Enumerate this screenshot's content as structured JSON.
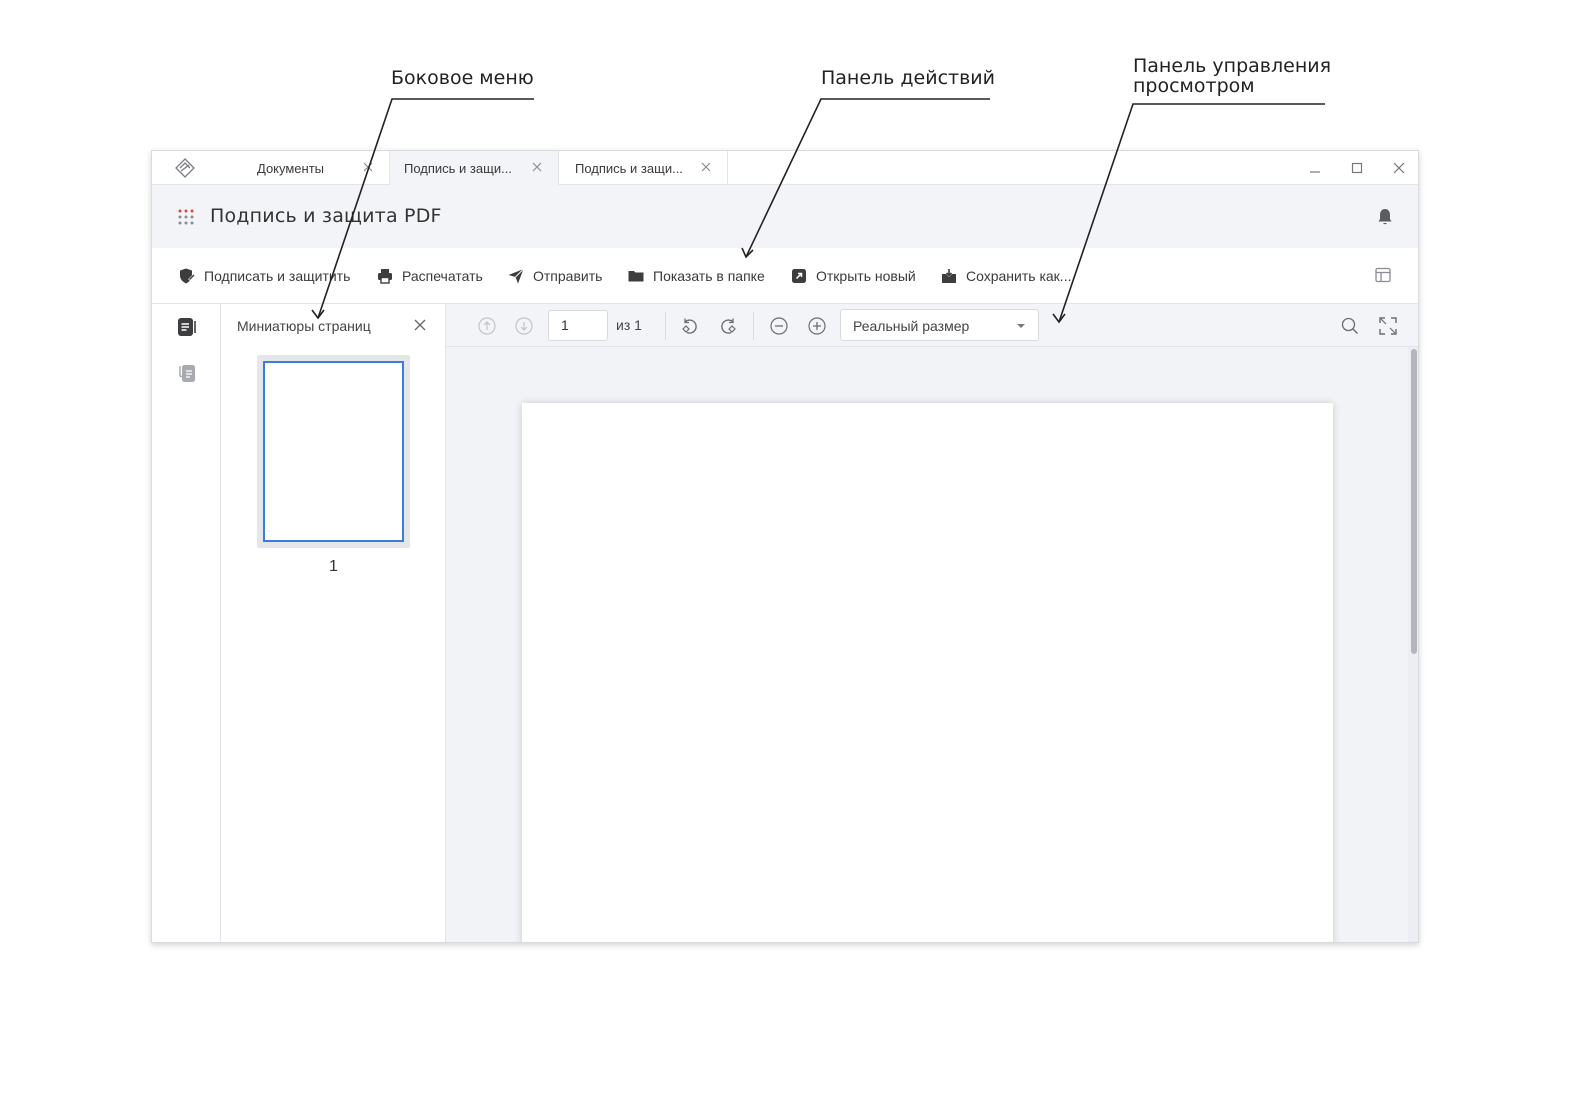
{
  "callouts": {
    "sidebar": "Боковое меню",
    "actions": "Панель действий",
    "view_control_line1": "Панель управления",
    "view_control_line2": "просмотром"
  },
  "tabs": [
    {
      "label": "Документы",
      "active": false
    },
    {
      "label": "Подпись и защи...",
      "active": true
    },
    {
      "label": "Подпись и защи...",
      "active": false
    }
  ],
  "header": {
    "title": "Подпись и защита PDF"
  },
  "actions": {
    "sign": "Подписать и защитить",
    "print": "Распечатать",
    "send": "Отправить",
    "show_in_folder": "Показать в папке",
    "open_new": "Открыть новый",
    "save_as": "Сохранить как..."
  },
  "thumbnails": {
    "title": "Миниатюры страниц",
    "pages": [
      "1"
    ]
  },
  "viewbar": {
    "page_value": "1",
    "of_label": "из 1",
    "zoom": "Реальный размер"
  },
  "colors": {
    "accent": "#3b7ddd",
    "header_bg": "#f3f4f7",
    "icon_dark": "#3d3d3f",
    "icon_muted": "#a8aab0",
    "logo_dots": "#d94a3a"
  }
}
